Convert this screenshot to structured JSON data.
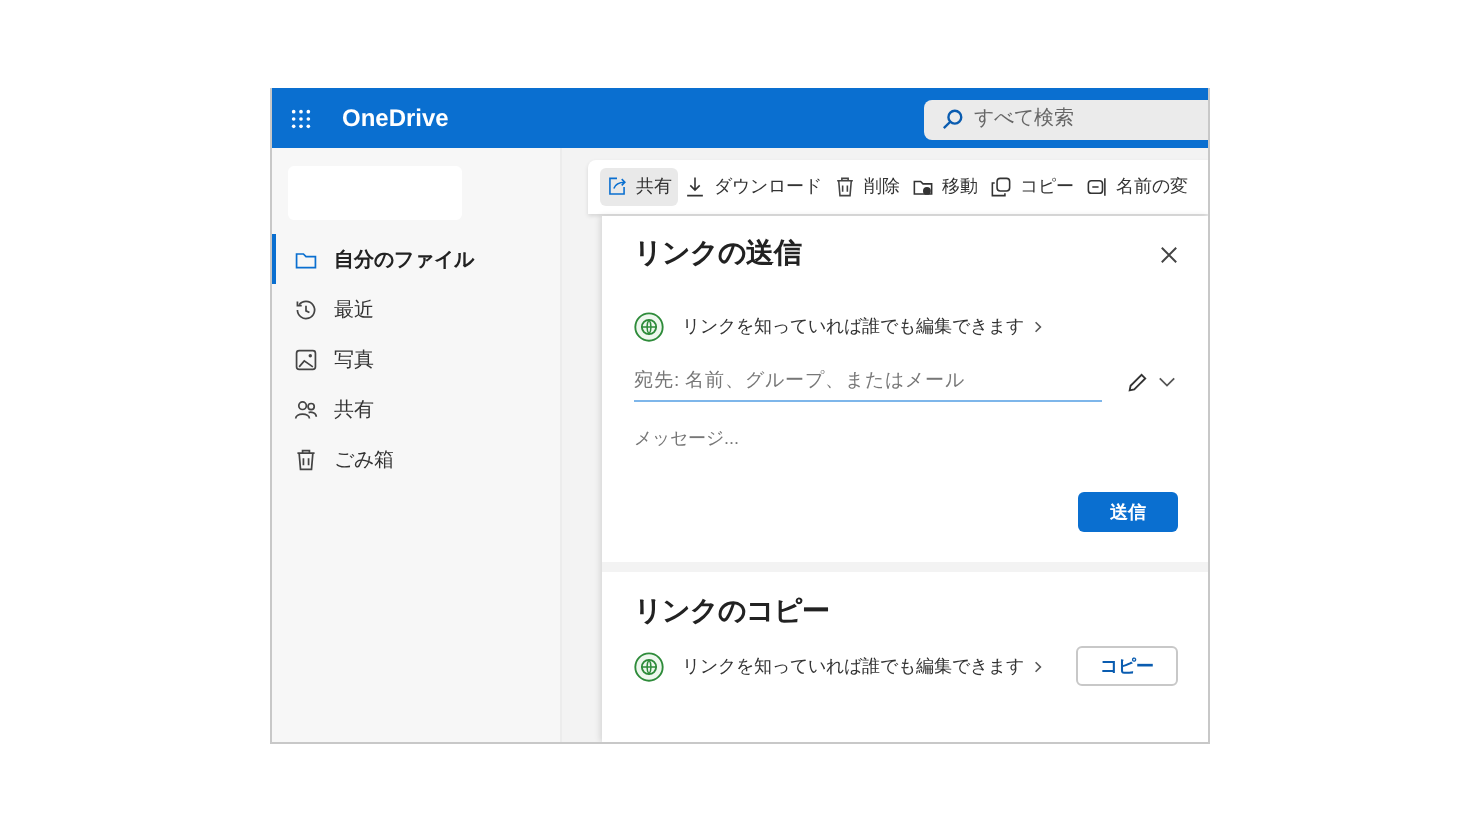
{
  "header": {
    "app_name": "OneDrive",
    "search": {
      "placeholder": "すべて検索"
    }
  },
  "sidebar": {
    "items": [
      {
        "label": "自分のファイル",
        "selected": true
      },
      {
        "label": "最近",
        "selected": false
      },
      {
        "label": "写真",
        "selected": false
      },
      {
        "label": "共有",
        "selected": false
      },
      {
        "label": "ごみ箱",
        "selected": false
      }
    ]
  },
  "toolbar": {
    "items": [
      {
        "label": "共有",
        "selected": true
      },
      {
        "label": "ダウンロード",
        "selected": false
      },
      {
        "label": "削除",
        "selected": false
      },
      {
        "label": "移動",
        "selected": false
      },
      {
        "label": "コピー",
        "selected": false
      },
      {
        "label": "名前の変",
        "selected": false
      }
    ]
  },
  "send_link": {
    "title": "リンクの送信",
    "link_setting": "リンクを知っていれば誰でも編集できます",
    "to": {
      "placeholder": "宛先: 名前、グループ、またはメール"
    },
    "message": {
      "placeholder": "メッセージ..."
    },
    "send_button": "送信"
  },
  "copy_link": {
    "title": "リンクのコピー",
    "link_setting": "リンクを知っていれば誰でも編集できます",
    "copy_button": "コピー"
  }
}
